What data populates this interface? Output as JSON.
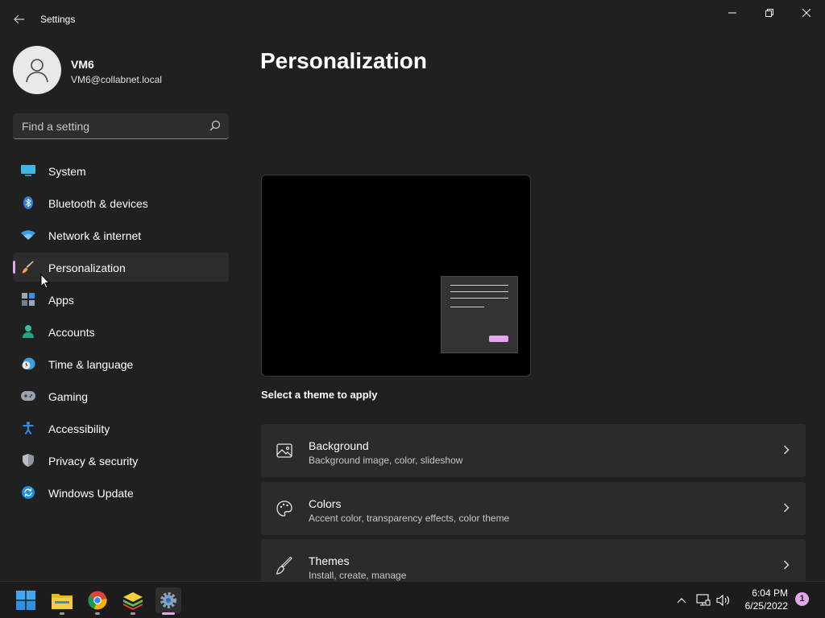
{
  "window": {
    "title": "Settings",
    "controls": [
      "minimize",
      "restore",
      "close"
    ]
  },
  "profile": {
    "name": "VM6",
    "email": "VM6@collabnet.local"
  },
  "search": {
    "placeholder": "Find a setting"
  },
  "nav": {
    "items": [
      {
        "label": "System",
        "icon": "monitor-icon"
      },
      {
        "label": "Bluetooth & devices",
        "icon": "bluetooth-icon"
      },
      {
        "label": "Network & internet",
        "icon": "wifi-icon"
      },
      {
        "label": "Personalization",
        "icon": "brush-icon",
        "selected": true
      },
      {
        "label": "Apps",
        "icon": "apps-icon"
      },
      {
        "label": "Accounts",
        "icon": "person-icon"
      },
      {
        "label": "Time & language",
        "icon": "clock-globe-icon"
      },
      {
        "label": "Gaming",
        "icon": "gamepad-icon"
      },
      {
        "label": "Accessibility",
        "icon": "accessibility-icon"
      },
      {
        "label": "Privacy & security",
        "icon": "shield-icon"
      },
      {
        "label": "Windows Update",
        "icon": "update-icon"
      }
    ]
  },
  "main": {
    "title": "Personalization",
    "theme_caption": "Select a theme to apply",
    "cards": [
      {
        "title": "Background",
        "subtitle": "Background image, color, slideshow",
        "icon": "image-icon"
      },
      {
        "title": "Colors",
        "subtitle": "Accent color, transparency effects, color theme",
        "icon": "palette-icon"
      },
      {
        "title": "Themes",
        "subtitle": "Install, create, manage",
        "icon": "brush-icon"
      }
    ]
  },
  "taskbar": {
    "apps": [
      "start-icon",
      "file-explorer-icon",
      "chrome-icon",
      "bluestacks-icon",
      "settings-icon"
    ],
    "active_app": "settings-icon",
    "time": "6:04 PM",
    "date": "6/25/2022",
    "notification_count": "1"
  },
  "colors": {
    "accent": "#e5a6f0",
    "background": "#202020",
    "card": "#2b2b2b"
  }
}
